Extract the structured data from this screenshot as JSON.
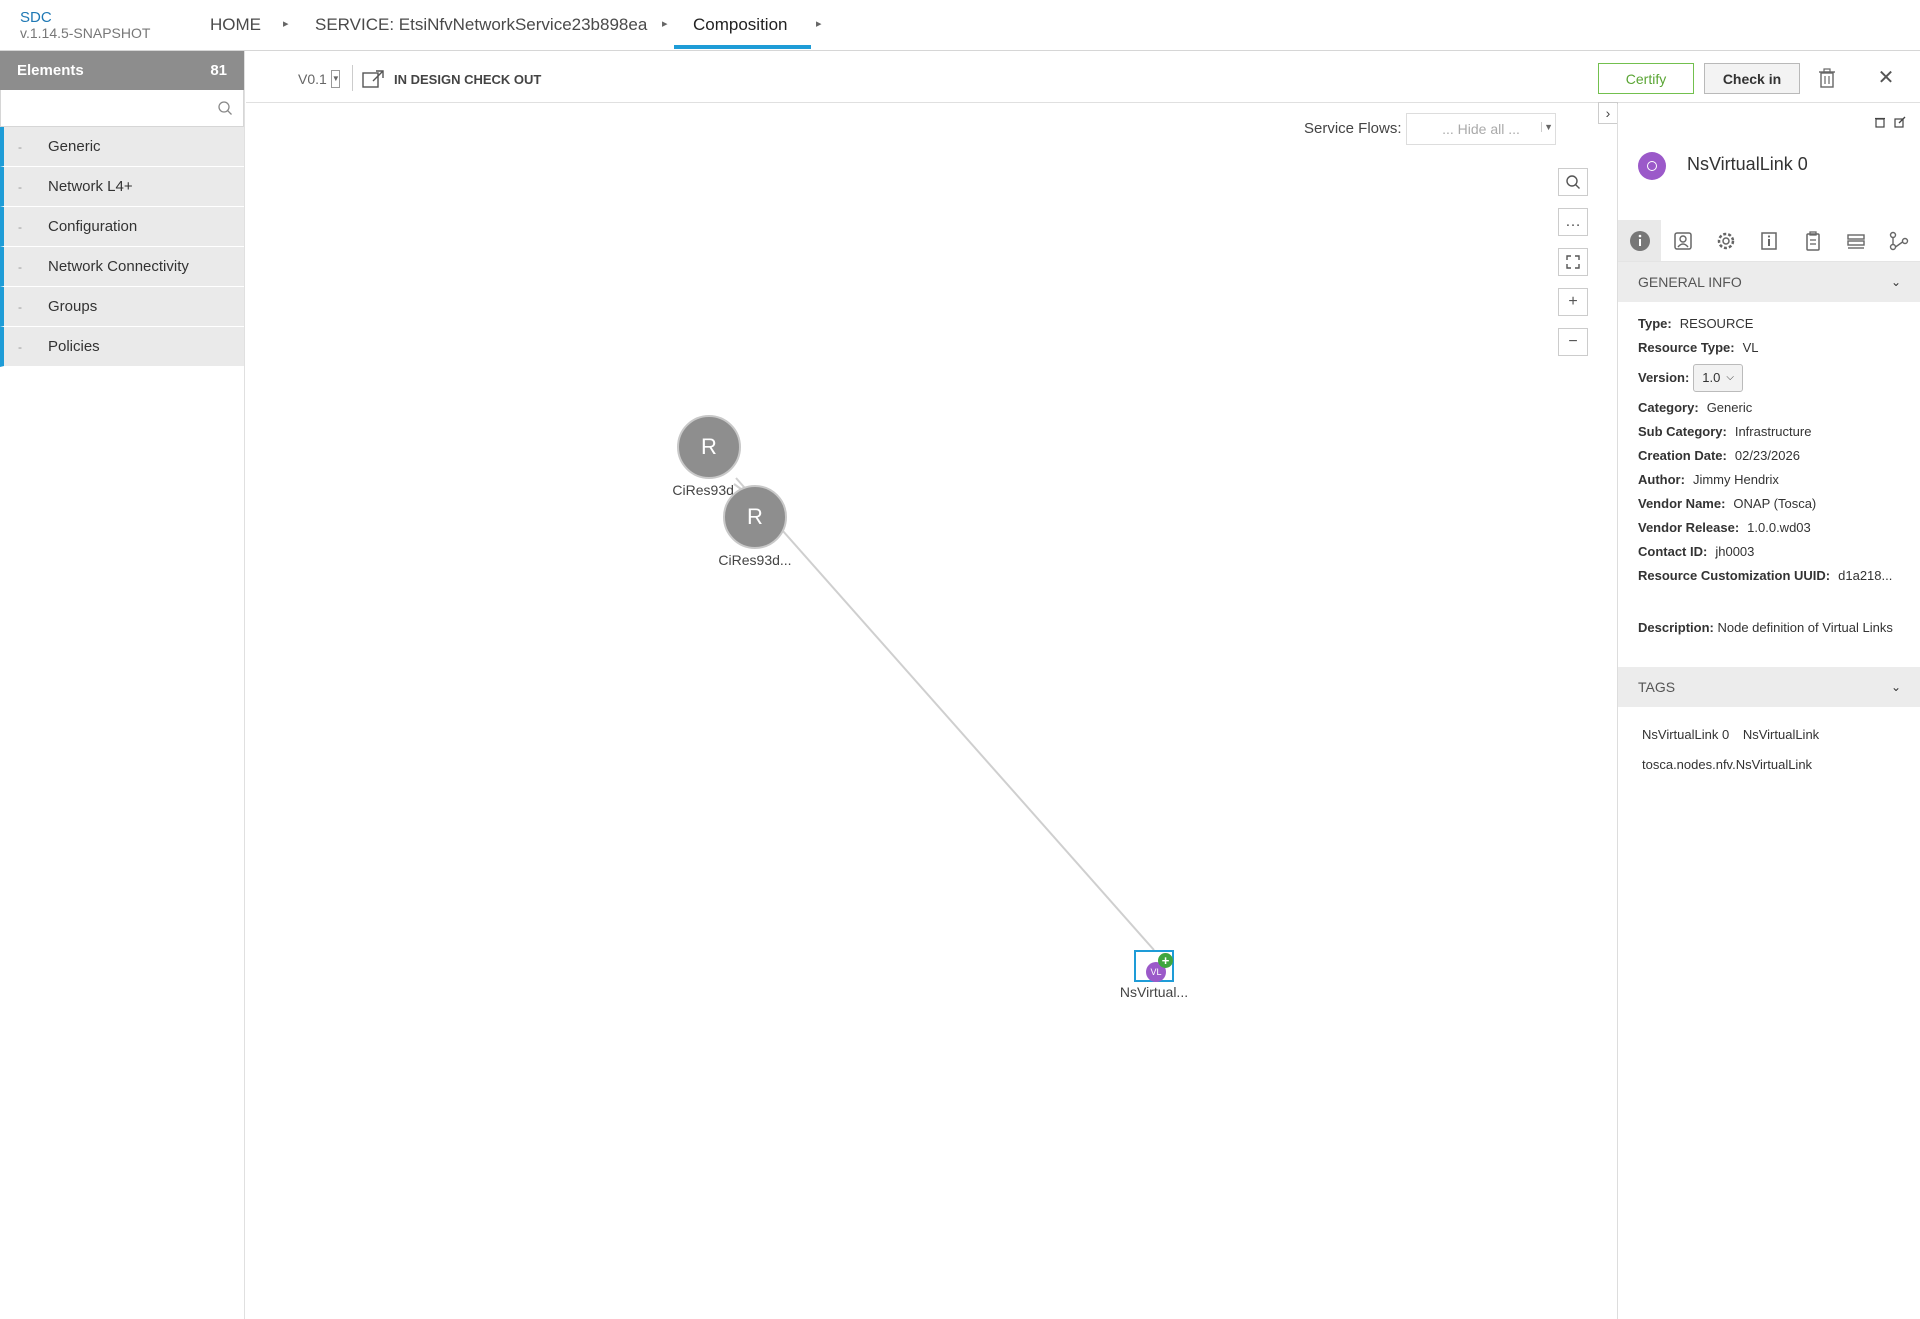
{
  "app": {
    "name": "SDC",
    "version": "v.1.14.5-SNAPSHOT"
  },
  "breadcrumb": {
    "home": "HOME",
    "service": "SERVICE: EtsiNfvNetworkService23b898ea",
    "current": "Composition"
  },
  "palette": {
    "title": "Elements",
    "count": "81",
    "search_placeholder": "",
    "categories": [
      {
        "label": "Generic"
      },
      {
        "label": "Network L4+"
      },
      {
        "label": "Configuration"
      },
      {
        "label": "Network Connectivity"
      },
      {
        "label": "Groups"
      },
      {
        "label": "Policies"
      }
    ]
  },
  "toolbar": {
    "version": "V0.1",
    "status": "IN DESIGN CHECK OUT",
    "certify_label": "Certify",
    "checkin_label": "Check in"
  },
  "canvas": {
    "service_flows_label": "Service Flows:",
    "service_flows_value": "... Hide all ...",
    "nodes": [
      {
        "letter": "R",
        "label": "CiRes93d..."
      },
      {
        "letter": "R",
        "label": "CiRes93d..."
      },
      {
        "badge": "VL",
        "label": "NsVirtual..."
      }
    ]
  },
  "details": {
    "title": "NsVirtualLink 0",
    "general_info_label": "GENERAL INFO",
    "fields": {
      "type": {
        "label": "Type:",
        "value": "RESOURCE"
      },
      "resource_type": {
        "label": "Resource Type:",
        "value": "VL"
      },
      "version": {
        "label": "Version:",
        "value": "1.0"
      },
      "category": {
        "label": "Category:",
        "value": "Generic"
      },
      "sub_category": {
        "label": "Sub Category:",
        "value": "Infrastructure"
      },
      "creation_date": {
        "label": "Creation Date:",
        "value": "02/23/2026"
      },
      "author": {
        "label": "Author:",
        "value": "Jimmy Hendrix"
      },
      "vendor_name": {
        "label": "Vendor Name:",
        "value": "ONAP (Tosca)"
      },
      "vendor_release": {
        "label": "Vendor Release:",
        "value": "1.0.0.wd03"
      },
      "contact_id": {
        "label": "Contact ID:",
        "value": "jh0003"
      },
      "customization_uuid": {
        "label": "Resource Customization UUID:",
        "value": "d1a218..."
      }
    },
    "description_label": "Description:",
    "description": "Node definition of Virtual Links",
    "tags_label": "TAGS",
    "tags": [
      "NsVirtualLink 0",
      "NsVirtualLink",
      "tosca.nodes.nfv.NsVirtualLink"
    ]
  },
  "colors": {
    "accent": "#1e9cd7",
    "certify_green": "#5aa534",
    "vl_purple": "#9b59c9",
    "node_gray": "#8e8e8e"
  }
}
